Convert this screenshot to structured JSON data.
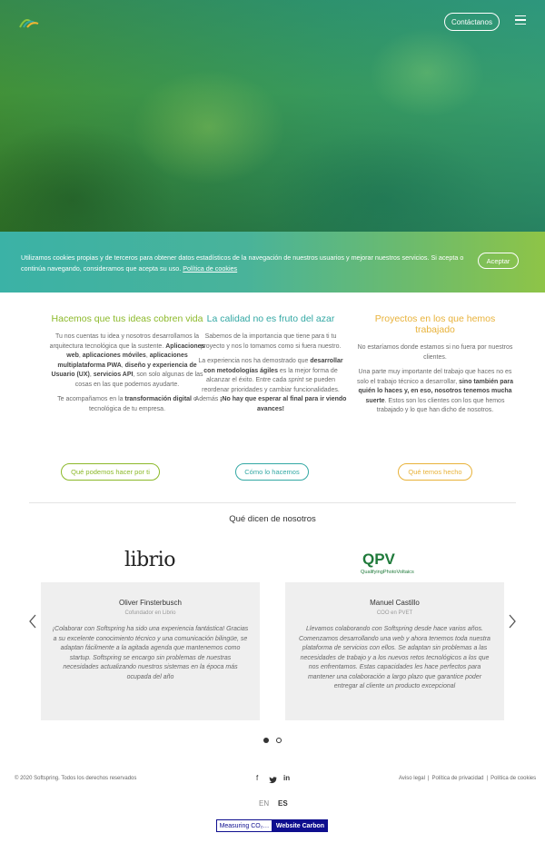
{
  "header": {
    "contact_label": "Contáctanos"
  },
  "cookies": {
    "text": "Utilizamos cookies propias y de terceros para obtener datos estadísticos de la navegación de nuestros usuarios y mejorar nuestros servicios. Si acepta o continúa navegando, consideramos que acepta su uso.",
    "policy_link": "Política de cookies",
    "accept_label": "Aceptar"
  },
  "columns": [
    {
      "title": "Hacemos que tus ideas cobren vida",
      "p1_a": "Tu nos cuentas tu idea y nosotros desarrollamos la arquitectura tecnológica que la sustente.",
      "p1_b1": "Aplicaciones web",
      "p1_c": ", ",
      "p1_b2": "aplicaciones móviles",
      "p1_d": ", ",
      "p1_b3": "aplicaciones multiplataforma PWA",
      "p1_e": ", ",
      "p1_b4": "diseño y experiencia de Usuario (UX)",
      "p1_f": ", ",
      "p1_b5": "servicios API",
      "p1_g": ", son solo algunas de las cosas en las que podemos ayudarte.",
      "p2_a": "Te acompañamos en la ",
      "p2_b": "transformación digital",
      "p2_c": " o tecnológica de tu empresa.",
      "button": "Qué podemos hacer por ti"
    },
    {
      "title": "La calidad no es fruto del azar",
      "p1": "Sabemos de la importancia que tiene para ti tu proyecto y nos lo tomamos como si fuera nuestro.",
      "p2_a": "La experiencia nos ha demostrado que ",
      "p2_b": "desarrollar con metodologías ágiles",
      "p2_c": " es la mejor forma de alcanzar el éxito. Entre cada ",
      "p2_i": "sprint",
      "p2_d": " se pueden reordenar prioridades y cambiar funcionalidades. Además ",
      "p2_e": "¡No hay que esperar al final para ir viendo avances!",
      "button": "Cómo lo hacemos"
    },
    {
      "title": "Proyectos en los que hemos trabajado",
      "p1": "No estaríamos donde estamos si no fuera por nuestros clientes.",
      "p2_a": "Una parte muy importante del trabajo que haces no es solo el trabajo técnico a desarrollar, ",
      "p2_b": "sino también para quién lo haces y, en eso, nosotros tenemos mucha suerte",
      "p2_c": ". Estos son los clientes con los que hemos trabajado y lo que han dicho de nosotros.",
      "button": "Qué temos hecho"
    }
  ],
  "testimonials": {
    "title": "Qué dicen de nosotros",
    "items": [
      {
        "logo_text": "librio",
        "name": "Oliver Finsterbusch",
        "role": "Cofundador en Librio",
        "quote": "¡Colaborar con Softspring ha sido una experiencia fantástica! Gracias a su excelente conocimiento técnico y una comunicación bilingüe, se adaptan fácilmente a la agitada agenda que mantenemos como startup. Softspring se encargo sin problemas de nuestras necesidades actualizando nuestros sistemas en la época más ocupada del año"
      },
      {
        "logo_text": "QPV",
        "logo_sub": "QualifyingPhotoVoltaics",
        "name": "Manuel Castillo",
        "role": "COO en PVET",
        "quote": "Llevamos colaborando con Softspring desde hace varios años. Comenzamos desarrollando una web y ahora tenemos toda nuestra plataforma de servicios con ellos. Se adaptan sin problemas a las necesidades de trabajo y a los nuevos retos tecnológicos a los que nos enfrentamos. Estas capacidades les hace perfectos para mantener una colaboración a largo plazo que garantice poder entregar al cliente un producto excepcional"
      }
    ]
  },
  "footer": {
    "copyright": "© 2020 Softspring. Todos los derechos reservados",
    "legal": "Aviso legal",
    "privacy": "Política de privacidad",
    "cookies": "Política de cookies",
    "sep": "|",
    "lang_en": "EN",
    "lang_es": "ES",
    "carbon_measure": "Measuring CO₂…",
    "carbon_site": "Website Carbon"
  },
  "colors": {
    "green": "#8cb92a",
    "teal": "#33a8a4",
    "yellow": "#e8b23a",
    "carbon_blue": "#0e0e8f"
  }
}
